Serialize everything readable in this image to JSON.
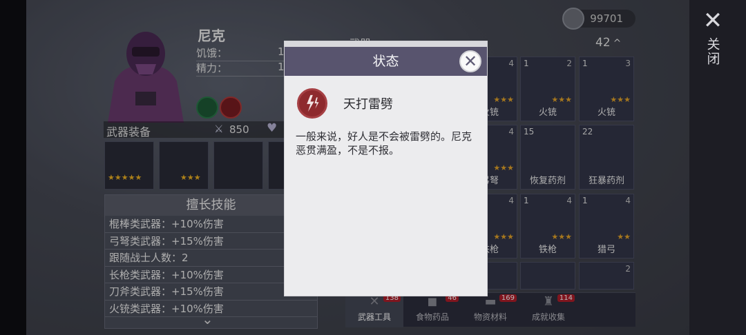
{
  "side": {
    "close_glyph": "✕",
    "close_label": "关闭"
  },
  "character": {
    "name": "尼克",
    "stats": [
      {
        "label": "饥饿：",
        "value": "1"
      },
      {
        "label": "精力：",
        "value": "1"
      }
    ]
  },
  "equipment": {
    "title": "武器装备",
    "attack_value": "850",
    "slots": [
      {
        "stars": "★★★★★"
      },
      {
        "stars": "★★★"
      },
      {
        "stars": ""
      },
      {
        "stars": ""
      }
    ]
  },
  "skills": {
    "title": "擅长技能",
    "rows": [
      "棍棒类武器：+10%伤害",
      "弓弩类武器：+15%伤害",
      "跟随战士人数：2",
      "长枪类武器：+10%伤害",
      "刀斧类武器：+15%伤害",
      "火铳类武器：+10%伤害"
    ],
    "more_glyph": "⌄"
  },
  "inventory": {
    "coins": "99701",
    "header": "武器",
    "count": "42",
    "count_glyph": "^",
    "items": [
      {
        "num": "",
        "tier": "",
        "name": "",
        "stars": ""
      },
      {
        "num": "",
        "tier": "",
        "name": "",
        "stars": ""
      },
      {
        "num": "",
        "tier": "4",
        "name": "火铳",
        "stars": "★★★"
      },
      {
        "num": "1",
        "tier": "2",
        "name": "火铳",
        "stars": "★★★"
      },
      {
        "num": "1",
        "tier": "3",
        "name": "火铳",
        "stars": "★★★"
      },
      {
        "num": "",
        "tier": "",
        "name": "",
        "stars": ""
      },
      {
        "num": "",
        "tier": "",
        "name": "",
        "stars": ""
      },
      {
        "num": "",
        "tier": "4",
        "name": "弓弩",
        "stars": "★★★"
      },
      {
        "num": "15",
        "tier": "",
        "name": "恢复药剂",
        "stars": ""
      },
      {
        "num": "22",
        "tier": "",
        "name": "狂暴药剂",
        "stars": ""
      },
      {
        "num": "",
        "tier": "",
        "name": "",
        "stars": ""
      },
      {
        "num": "",
        "tier": "",
        "name": "",
        "stars": ""
      },
      {
        "num": "",
        "tier": "4",
        "name": "铁枪",
        "stars": "★★★"
      },
      {
        "num": "1",
        "tier": "4",
        "name": "铁枪",
        "stars": "★★★"
      },
      {
        "num": "1",
        "tier": "4",
        "name": "猎弓",
        "stars": "★★"
      },
      {
        "num": "",
        "tier": "",
        "name": "",
        "stars": ""
      },
      {
        "num": "",
        "tier": "",
        "name": "",
        "stars": ""
      },
      {
        "num": "",
        "tier": "",
        "name": "",
        "stars": ""
      },
      {
        "num": "",
        "tier": "",
        "name": "",
        "stars": ""
      },
      {
        "num": "",
        "tier": "2",
        "name": "",
        "stars": ""
      }
    ],
    "tabs": [
      {
        "label": "武器工具",
        "badge": "138",
        "icon": "✕"
      },
      {
        "label": "食物药品",
        "badge": "46",
        "icon": "◼"
      },
      {
        "label": "物资材料",
        "badge": "169",
        "icon": "▬"
      },
      {
        "label": "成就收集",
        "badge": "114",
        "icon": "♜"
      }
    ]
  },
  "dialog": {
    "title": "状态",
    "close_glyph": "✕",
    "status_name": "天打雷劈",
    "description": "一般来说，好人是不会被雷劈的。尼克恶贯满盈，不是不报。",
    "icon": "lightning-icon"
  },
  "colors": {
    "dialog_header": "#58546e",
    "status_icon": "#8e2a2e",
    "star": "#f0b323",
    "badge": "#b21e2a"
  }
}
